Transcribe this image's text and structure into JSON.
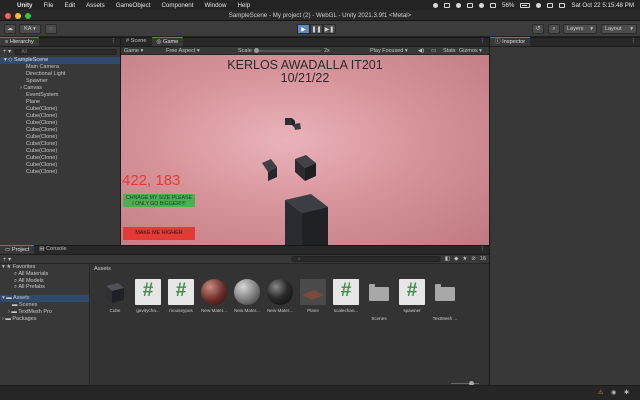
{
  "menubar": {
    "apple": "",
    "app": "Unity",
    "items": [
      "File",
      "Edit",
      "Assets",
      "GameObject",
      "Component",
      "Window",
      "Help"
    ],
    "battery": "56%",
    "datetime": "Sat Oct 22  5:15:48 PM"
  },
  "window": {
    "title": "SampleScene - My project (2) - WebGL - Unity 2021.3.9f1 <Metal>"
  },
  "toolbar": {
    "account": "KA",
    "layers": "Layers",
    "layout": "Layout"
  },
  "hierarchy": {
    "tab": "Hierarchy",
    "search_placeholder": "All",
    "scene": "SampleScene",
    "items": [
      "Main Camera",
      "Directional Light",
      "Spawner",
      "Canvas",
      "EventSystem",
      "Plane",
      "Cube(Clone)",
      "Cube(Clone)",
      "Cube(Clone)",
      "Cube(Clone)",
      "Cube(Clone)",
      "Cube(Clone)",
      "Cube(Clone)",
      "Cube(Clone)",
      "Cube(Clone)",
      "Cube(Clone)"
    ]
  },
  "game": {
    "tabs": [
      "Scene",
      "Game"
    ],
    "display": "Game",
    "aspect": "Free Aspect",
    "scale_label": "Scale",
    "scale_value": "2x",
    "play_focused": "Play Focused",
    "stats": "Stats",
    "gizmos": "Gizmos",
    "title_line1": "KERLOS AWADALLA IT201",
    "title_line2": "10/21/22",
    "coords": "422, 183",
    "green_button_line1": "CHNAGE MY SIZE PLEASE",
    "green_button_line2": "I ONLY GO BIGGER!!!!",
    "red_button": "MAKE ME HIGHER"
  },
  "inspector": {
    "tab": "Inspector"
  },
  "project": {
    "tabs": [
      "Project",
      "Console"
    ],
    "badge_count": "16",
    "favorites": "Favorites",
    "fav_items": [
      "All Materials",
      "All Models",
      "All Prefabs"
    ],
    "assets": "Assets",
    "asset_children": [
      "Scenes",
      "TextMesh Pro"
    ],
    "packages": "Packages",
    "breadcrumb": "Assets",
    "files": [
      {
        "label": "Cube",
        "kind": "cube"
      },
      {
        "label": "gavitycha...",
        "kind": "script"
      },
      {
        "label": "mouseypos",
        "kind": "script"
      },
      {
        "label": "New Mater...",
        "kind": "mat-red"
      },
      {
        "label": "New Mater...",
        "kind": "mat-grey"
      },
      {
        "label": "New Mater...",
        "kind": "mat-black"
      },
      {
        "label": "Plane",
        "kind": "plane"
      },
      {
        "label": "scalechan...",
        "kind": "script"
      },
      {
        "label": "Scenes",
        "kind": "folder"
      },
      {
        "label": "spawner",
        "kind": "script"
      },
      {
        "label": "TextMesh ...",
        "kind": "folder"
      }
    ]
  },
  "colors": {
    "accent": "#4a7bb8",
    "game_bg": "#d8949b",
    "green_button": "#4caf50",
    "red_button": "#e53935",
    "coords_text": "#e53935",
    "script_icon": "#3f8f4a"
  }
}
